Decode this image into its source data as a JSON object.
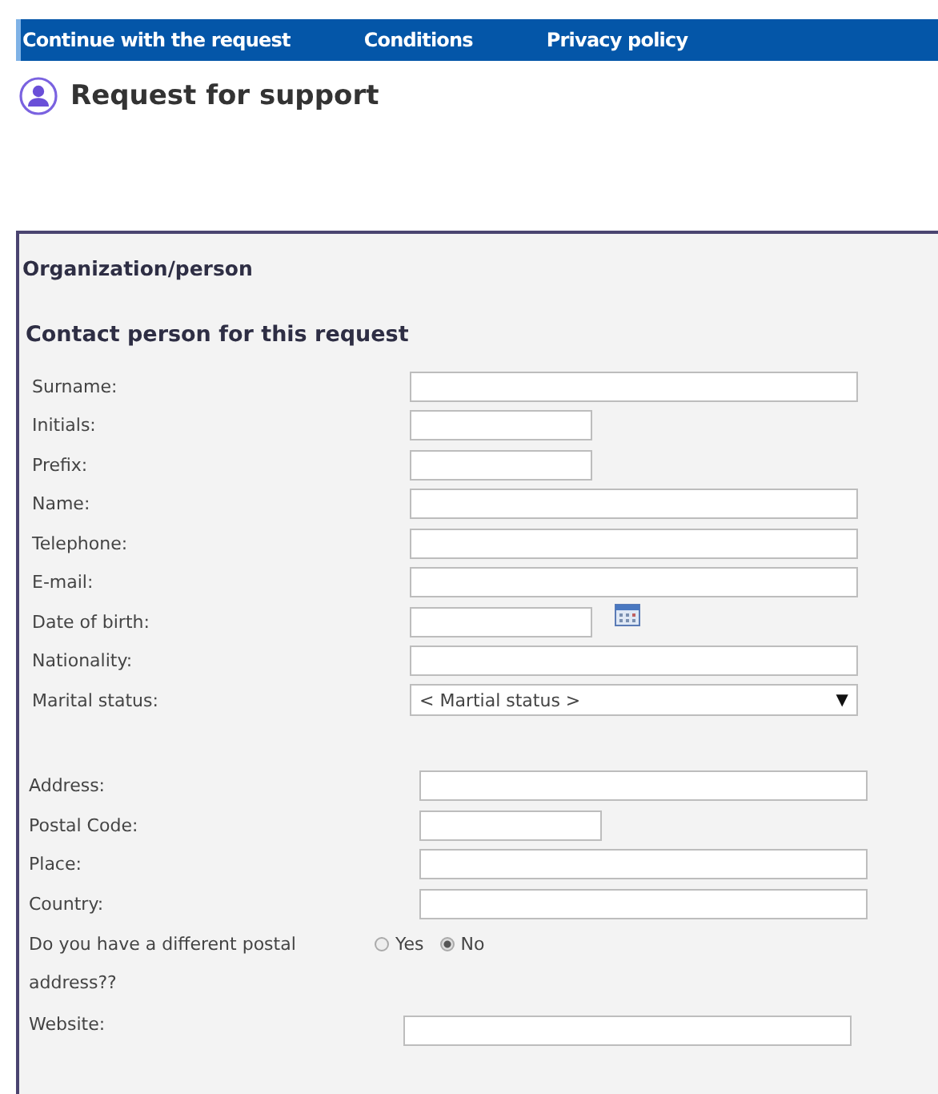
{
  "nav": [
    {
      "label": "Continue with the request"
    },
    {
      "label": "Conditions"
    },
    {
      "label": "Privacy policy"
    }
  ],
  "page_title": "Request for support",
  "form": {
    "section": "Organization/person",
    "subsection": "Contact person for this request",
    "groups": [
      {
        "fields": [
          {
            "kind": "text",
            "label": "Surname:"
          },
          {
            "kind": "short",
            "label": "Initials:"
          },
          {
            "kind": "short",
            "label": "Prefix:"
          },
          {
            "kind": "text",
            "label": "Name:"
          },
          {
            "kind": "text",
            "label": "Telephone:"
          },
          {
            "kind": "text",
            "label": "E-mail:"
          },
          {
            "kind": "date",
            "label": "Date of birth:"
          },
          {
            "kind": "text",
            "label": "Nationality:"
          },
          {
            "kind": "select",
            "label": "Marital status:",
            "value": "< Martial status >",
            "arrow": "▼"
          }
        ]
      },
      {
        "fields": [
          {
            "kind": "text",
            "label": "Address:"
          },
          {
            "kind": "short",
            "label": "Postal Code:"
          },
          {
            "kind": "text",
            "label": "Place:"
          },
          {
            "kind": "text",
            "label": "Country:"
          },
          {
            "kind": "radio",
            "label": "Do you have a different postal address??",
            "options": [
              {
                "label": "Yes",
                "selected": false
              },
              {
                "label": "No",
                "selected": true
              }
            ]
          },
          {
            "kind": "website",
            "label": "Website:"
          }
        ]
      }
    ]
  }
}
